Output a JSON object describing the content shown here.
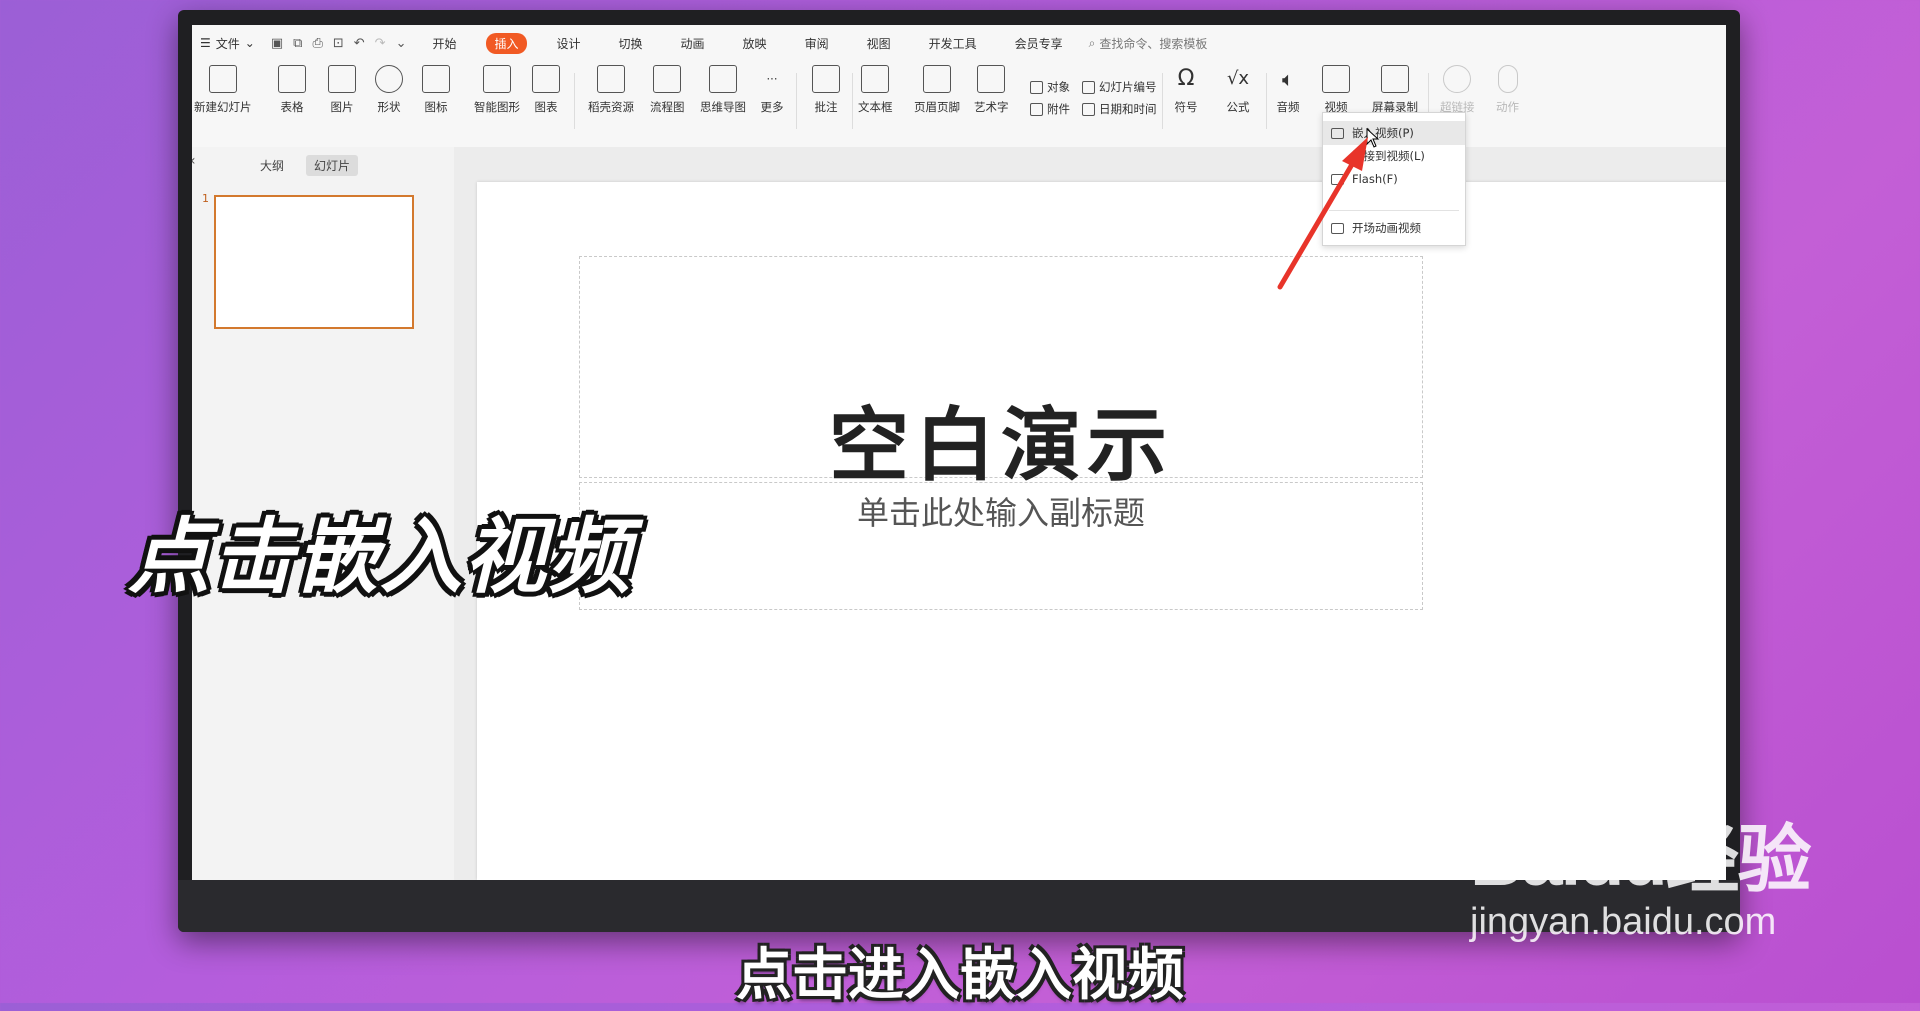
{
  "menubar": {
    "file_label": "文件",
    "tabs": [
      "开始",
      "插入",
      "设计",
      "切换",
      "动画",
      "放映",
      "审阅",
      "视图",
      "开发工具",
      "会员专享"
    ],
    "active_tab": "插入",
    "search_placeholder": "查找命令、搜索模板"
  },
  "ribbon": {
    "buttons": [
      "新建幻灯片",
      "表格",
      "图片",
      "形状",
      "图标",
      "智能图形",
      "图表",
      "稻壳资源",
      "流程图",
      "思维导图",
      "更多",
      "批注",
      "文本框",
      "页眉页脚",
      "艺术字",
      "符号",
      "公式",
      "音频",
      "视频",
      "屏幕录制",
      "超链接",
      "动作"
    ],
    "small": [
      "对象",
      "幻灯片编号",
      "附件",
      "日期和时间"
    ]
  },
  "left_pane": {
    "tabs": [
      "大纲",
      "幻灯片"
    ],
    "active_tab": "幻灯片",
    "slide_number": "1"
  },
  "slide": {
    "title": "空白演示",
    "subtitle": "单击此处输入副标题"
  },
  "video_dropdown": {
    "items": [
      "嵌入视频(P)",
      "链接到视频(L)",
      "Flash(F)",
      "开场动画视频"
    ]
  },
  "overlay": {
    "headline": "点击嵌入视频",
    "caption": "点击进入嵌入视频"
  },
  "watermark": {
    "logo": "Baidu经验",
    "url": "jingyan.baidu.com"
  },
  "colors": {
    "accent": "#f15a24",
    "arrow": "#e8342a"
  }
}
